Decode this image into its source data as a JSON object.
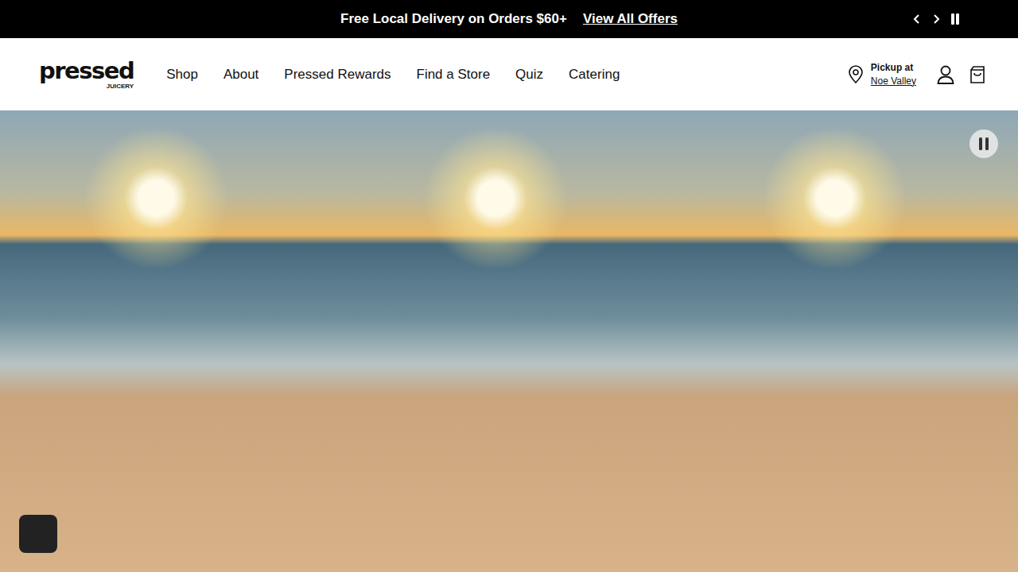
{
  "announcement": {
    "text": "Free Local Delivery on Orders $60+",
    "link": "View All Offers",
    "playing": true
  },
  "logo": {
    "word": "pressed",
    "sub": "JUICERY"
  },
  "nav": [
    {
      "label": "Shop"
    },
    {
      "label": "About"
    },
    {
      "label": "Pressed Rewards"
    },
    {
      "label": "Find a Store"
    },
    {
      "label": "Quiz"
    },
    {
      "label": "Catering"
    }
  ],
  "pickup": {
    "label": "Pickup at",
    "store": "Noe Valley"
  },
  "hero": {
    "panels": 3,
    "playing": true
  }
}
